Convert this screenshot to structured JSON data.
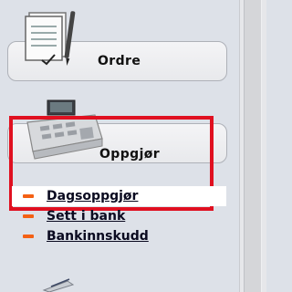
{
  "menu": {
    "tiles": [
      {
        "label": "Ordre",
        "icon": "document-pen-icon"
      },
      {
        "label": "Oppgjør",
        "icon": "cash-register-icon"
      }
    ],
    "sub_items": [
      {
        "label": "Dagsoppgjør",
        "selected": true
      },
      {
        "label": "Sett i bank",
        "selected": false
      },
      {
        "label": "Bankinnskudd",
        "selected": false
      }
    ]
  },
  "colors": {
    "highlight_border": "#e01020",
    "bullet": "#f46014",
    "panel_bg": "#dde1e8"
  }
}
